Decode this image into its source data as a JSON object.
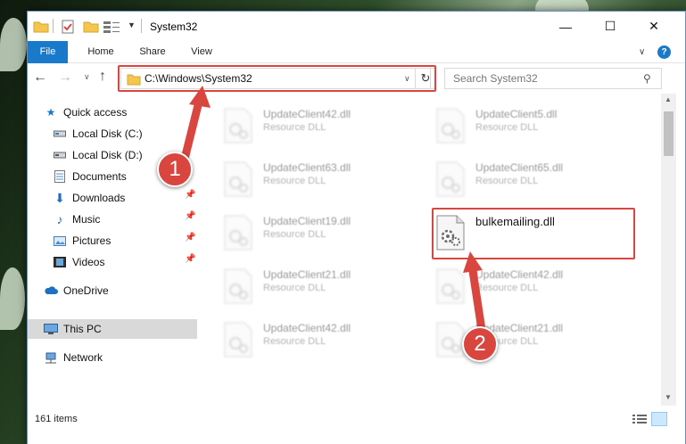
{
  "window": {
    "title": "System32"
  },
  "ribbon": {
    "tabs": [
      "File",
      "Home",
      "Share",
      "View"
    ],
    "help": "?"
  },
  "navbar": {
    "address": "C:\\Windows\\System32",
    "search_placeholder": "Search System32"
  },
  "sidebar": {
    "items": [
      {
        "label": "Quick access",
        "icon": "star-icon"
      },
      {
        "label": "Local Disk (C:)",
        "icon": "drive-icon"
      },
      {
        "label": "Local Disk (D:)",
        "icon": "drive-icon"
      },
      {
        "label": "Documents",
        "icon": "documents-icon"
      },
      {
        "label": "Downloads",
        "icon": "download-icon"
      },
      {
        "label": "Music",
        "icon": "music-icon"
      },
      {
        "label": "Pictures",
        "icon": "pictures-icon"
      },
      {
        "label": "Videos",
        "icon": "videos-icon"
      },
      {
        "label": "OneDrive",
        "icon": "cloud-icon"
      },
      {
        "label": "This PC",
        "icon": "computer-icon"
      },
      {
        "label": "Network",
        "icon": "network-icon"
      }
    ]
  },
  "files": [
    {
      "name": "UpdateClient42.dll",
      "type": "Resource DLL"
    },
    {
      "name": "UpdateClient5.dll",
      "type": "Resource DLL"
    },
    {
      "name": "UpdateClient63.dll",
      "type": "Resource DLL"
    },
    {
      "name": "UpdateClient65.dll",
      "type": "Resource DLL"
    },
    {
      "name": "UpdateClient19.dll",
      "type": "Resource DLL"
    },
    {
      "name": "bulkemailing.dll",
      "type": ""
    },
    {
      "name": "UpdateClient21.dll",
      "type": "Resource DLL"
    },
    {
      "name": "UpdateClient42.dll",
      "type": "Resource DLL"
    },
    {
      "name": "UpdateClient42.dll",
      "type": "Resource DLL"
    },
    {
      "name": "UpdateClient21.dll",
      "type": "Resource DLL"
    }
  ],
  "status": {
    "item_count": "161 items"
  },
  "annotations": {
    "step1": "1",
    "step2": "2",
    "color": "#d9463f"
  }
}
